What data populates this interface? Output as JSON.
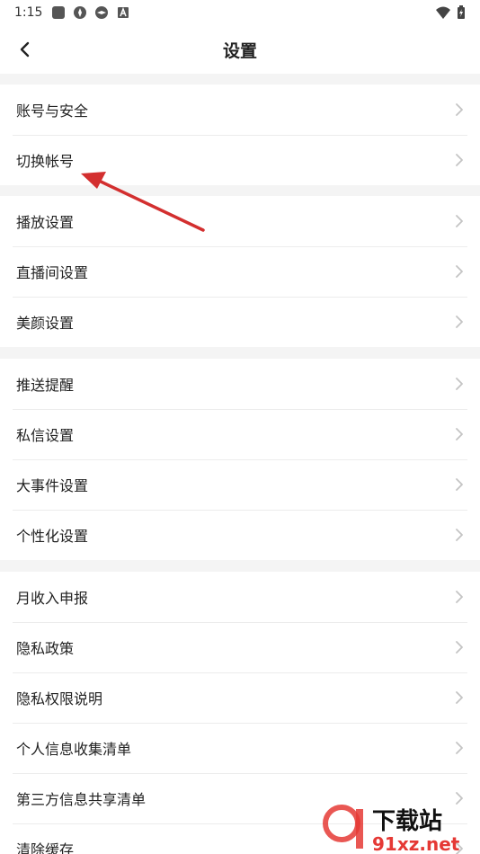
{
  "status_bar": {
    "time": "1:15"
  },
  "header": {
    "title": "设置"
  },
  "sections": [
    {
      "items": [
        {
          "label": "账号与安全"
        },
        {
          "label": "切换帐号"
        }
      ]
    },
    {
      "items": [
        {
          "label": "播放设置"
        },
        {
          "label": "直播间设置"
        },
        {
          "label": "美颜设置"
        }
      ]
    },
    {
      "items": [
        {
          "label": "推送提醒"
        },
        {
          "label": "私信设置"
        },
        {
          "label": "大事件设置"
        },
        {
          "label": "个性化设置"
        }
      ]
    },
    {
      "items": [
        {
          "label": "月收入申报"
        },
        {
          "label": "隐私政策"
        },
        {
          "label": "隐私权限说明"
        },
        {
          "label": "个人信息收集清单"
        },
        {
          "label": "第三方信息共享清单"
        },
        {
          "label": "清除缓存"
        }
      ]
    }
  ],
  "watermark": {
    "main": "下载站",
    "sub": "91xz.net"
  },
  "colors": {
    "annotation_arrow": "#d32f2f",
    "watermark": "#e53935"
  }
}
